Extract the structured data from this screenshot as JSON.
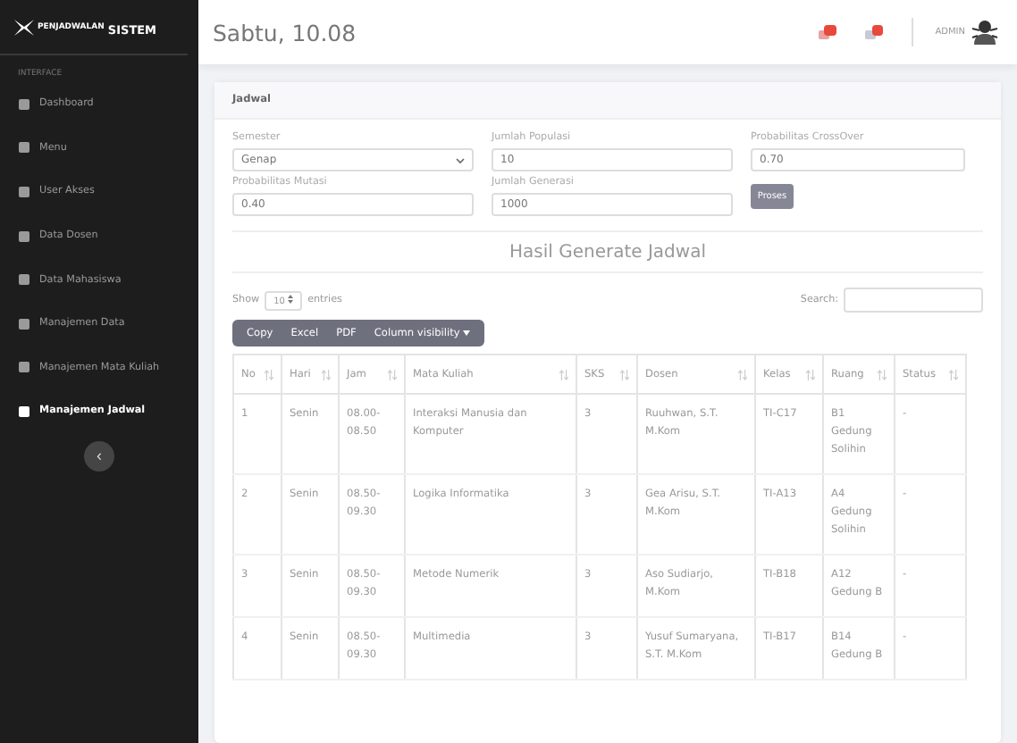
{
  "sidebar": {
    "brand_left": "PENJADWALAN",
    "brand_right": "SISTEM",
    "section": "INTERFACE",
    "items": [
      {
        "label": "Dashboard",
        "selected": false
      },
      {
        "label": "Menu",
        "selected": false
      },
      {
        "label": "User Akses",
        "selected": false
      },
      {
        "label": "Data Dosen",
        "selected": false
      },
      {
        "label": "Data Mahasiswa",
        "selected": false
      },
      {
        "label": "Manajemen Data",
        "selected": false
      },
      {
        "label": "Manajemen Mata Kuliah",
        "selected": false
      },
      {
        "label": "Manajemen Jadwal",
        "selected": true
      }
    ],
    "collapse": "‹"
  },
  "header": {
    "title": "Sabtu, 10.08",
    "user": "ADMIN"
  },
  "card": {
    "title": "Jadwal",
    "fields": [
      {
        "label": "Semester",
        "value": "Genap",
        "kind": "select"
      },
      {
        "label": "Jumlah Populasi",
        "value": "10",
        "kind": "input"
      },
      {
        "label": "Probabilitas CrossOver",
        "value": "0.70",
        "kind": "input"
      },
      {
        "label": "Probabilitas Mutasi",
        "value": "0.40",
        "kind": "input"
      },
      {
        "label": "Jumlah Generasi",
        "value": "1000",
        "kind": "input"
      }
    ],
    "button": "Proses",
    "result_title": "Hasil Generate Jadwal",
    "length": {
      "show": "Show",
      "value": "10",
      "entries": "entries"
    },
    "search_label": "Search:",
    "export_buttons": [
      "Copy",
      "Excel",
      "PDF",
      "Column visibility"
    ],
    "table": {
      "columns": [
        "No",
        "Hari",
        "Jam",
        "Mata Kuliah",
        "SKS",
        "Dosen",
        "Kelas",
        "Ruang",
        "Status"
      ],
      "rows": [
        [
          "1",
          "Senin",
          "08.00-08.50",
          "Interaksi Manusia dan Komputer",
          "3",
          "Ruuhwan, S.T. M.Kom",
          "TI-C17",
          "B1 Gedung Solihin",
          "-"
        ],
        [
          "2",
          "Senin",
          "08.50-09.30",
          "Logika Informatika",
          "3",
          "Gea Arisu, S.T. M.Kom",
          "TI-A13",
          "A4 Gedung Solihin",
          "-"
        ],
        [
          "3",
          "Senin",
          "08.50-09.30",
          "Metode Numerik",
          "3",
          "Aso Sudiarjo, M.Kom",
          "TI-B18",
          "A12 Gedung B",
          "-"
        ],
        [
          "4",
          "Senin",
          "08.50-09.30",
          "Multimedia",
          "3",
          "Yusuf Sumaryana, S.T. M.Kom",
          "TI-B17",
          "B14 Gedung B",
          "-"
        ]
      ]
    }
  }
}
